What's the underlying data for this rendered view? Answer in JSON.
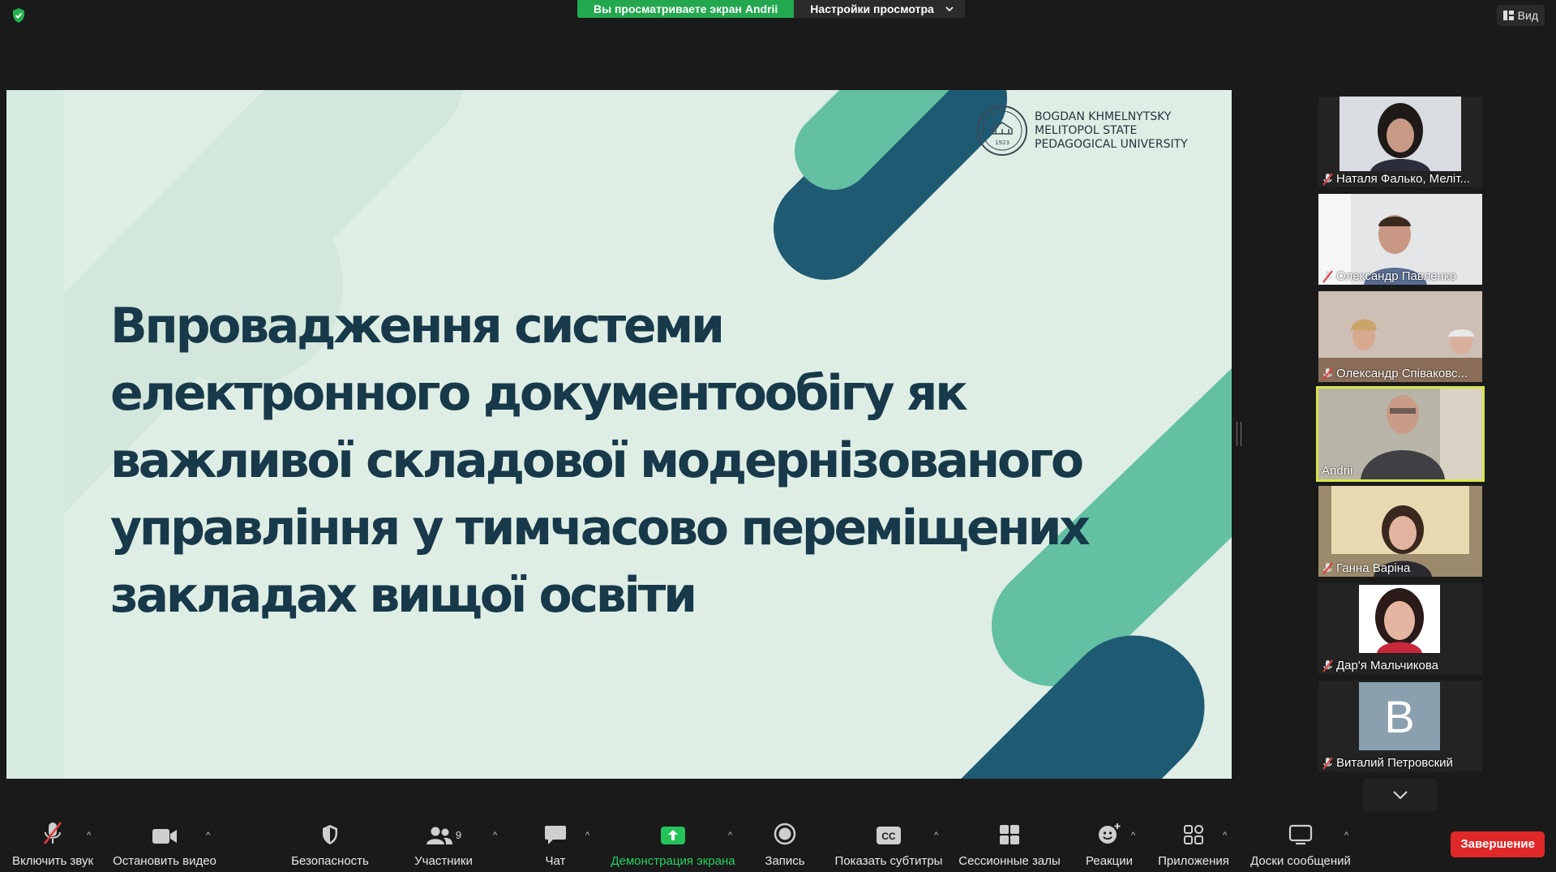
{
  "top": {
    "sharing_banner": "Вы просматриваете экран Andrii",
    "view_settings": "Настройки просмотра",
    "view_button": "Вид"
  },
  "slide": {
    "title_lines": [
      "Впровадження системи",
      "електронного документообігу як",
      "важливої складової модернізованого",
      "управління у тимчасово переміщених",
      "закладах вищої освіти"
    ],
    "university_lines": [
      "BOGDAN KHMELNYTSKY",
      "MELITOPOL STATE",
      "PEDAGOGICAL UNIVERSITY"
    ],
    "seal_year": "1923",
    "colors": {
      "bg": "#dfeee5",
      "teal": "#63c0a2",
      "navy": "#1f5a73",
      "text": "#17394a"
    }
  },
  "participants": [
    {
      "name": "Наталя Фалько, Меліт...",
      "muted": true,
      "active": false
    },
    {
      "name": "Олександр Павленко",
      "muted": true,
      "active": false
    },
    {
      "name": "Олександр Співаковс...",
      "muted": true,
      "active": false
    },
    {
      "name": "Andrii",
      "muted": false,
      "active": true
    },
    {
      "name": "Ганна Варіна",
      "muted": true,
      "active": false
    },
    {
      "name": "Дар'я Мальчикова",
      "muted": true,
      "active": false
    },
    {
      "name": "Виталий Петровский",
      "muted": true,
      "active": false,
      "avatar_letter": "B"
    }
  ],
  "toolbar": {
    "unmute": "Включить звук",
    "stop_video": "Остановить видео",
    "security": "Безопасность",
    "participants": "Участники",
    "participants_count": "9",
    "chat": "Чат",
    "share_screen": "Демонстрация экрана",
    "record": "Запись",
    "captions": "Показать субтитры",
    "captions_icon_text": "CC",
    "breakout": "Сессионные залы",
    "reactions": "Реакции",
    "apps": "Приложения",
    "whiteboards": "Доски сообщений",
    "end": "Завершение"
  },
  "accent": {
    "green": "#23a84f",
    "end_red": "#e02828",
    "highlight": "#d6e54c"
  }
}
